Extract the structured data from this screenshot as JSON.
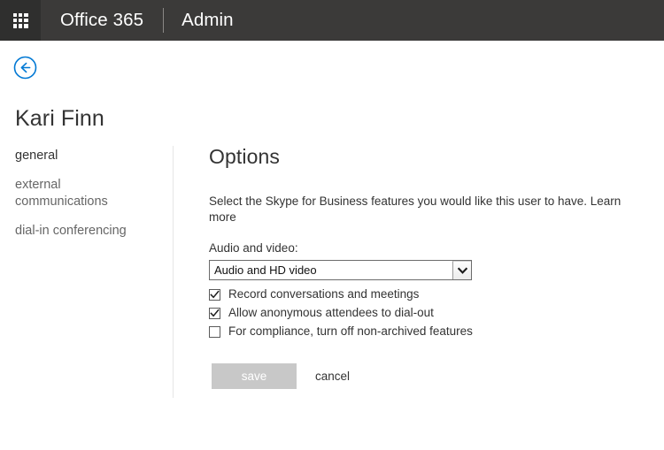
{
  "suitebar": {
    "waffle_icon": "app-launcher-waffle-icon",
    "suite_name": "Office 365",
    "app_name": "Admin"
  },
  "page": {
    "back_icon": "back-arrow-circle-icon",
    "person_title": "Kari Finn"
  },
  "leftnav": {
    "items": [
      {
        "label": "general",
        "active": true
      },
      {
        "label": "external communications",
        "active": false
      },
      {
        "label": "dial-in conferencing",
        "active": false
      }
    ]
  },
  "main": {
    "panel_title": "Options",
    "description_text": "Select the Skype for Business features you would like this user to have.",
    "learn_more_label": "Learn more",
    "audio_video": {
      "label": "Audio and video:",
      "selected": "Audio and HD video",
      "chevron_icon": "chevron-down-icon",
      "options": [
        "Audio and HD video"
      ]
    },
    "checkboxes": [
      {
        "label": "Record conversations and meetings",
        "checked": true
      },
      {
        "label": "Allow anonymous attendees to dial-out",
        "checked": true
      },
      {
        "label": "For compliance, turn off non-archived features",
        "checked": false
      }
    ]
  },
  "actions": {
    "save_label": "save",
    "cancel_label": "cancel",
    "save_disabled": true
  },
  "colors": {
    "suitebar_background": "#3b3a39",
    "waffle_background": "#2f2f2e",
    "accent_blue": "#0078d4",
    "text_primary": "#333333",
    "text_secondary": "#666666",
    "divider": "#e6e6e6",
    "save_disabled_background": "#c8c8c8"
  }
}
